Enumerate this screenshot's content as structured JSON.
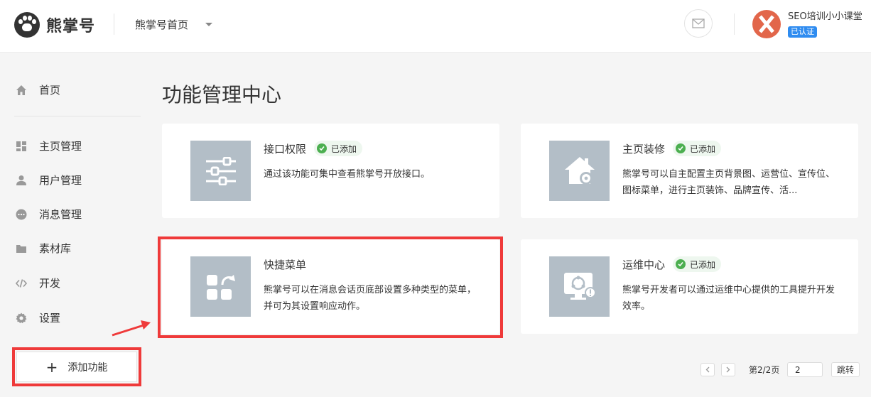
{
  "header": {
    "logo_text": "熊掌号",
    "account_select": "熊掌号首页",
    "user_name": "SEO培训小小课堂",
    "verified_badge": "已认证"
  },
  "sidebar": {
    "items": [
      {
        "label": "首页",
        "icon": "home-icon"
      },
      {
        "label": "主页管理",
        "icon": "dashboard-icon"
      },
      {
        "label": "用户管理",
        "icon": "user-icon"
      },
      {
        "label": "消息管理",
        "icon": "message-icon"
      },
      {
        "label": "素材库",
        "icon": "folder-icon"
      },
      {
        "label": "开发",
        "icon": "code-icon"
      },
      {
        "label": "设置",
        "icon": "gear-icon"
      }
    ],
    "add_button": "添加功能"
  },
  "main": {
    "title": "功能管理中心",
    "cards": [
      {
        "title": "接口权限",
        "badge": "已添加",
        "desc": "通过该功能可集中查看熊掌号开放接口。",
        "icon": "sliders-icon"
      },
      {
        "title": "主页装修",
        "badge": "已添加",
        "desc": "熊掌号可以自主配置主页背景图、运营位、宣传位、图标菜单，进行主页装饰、品牌宣传、活...",
        "icon": "home-settings-icon"
      },
      {
        "title": "快捷菜单",
        "badge": "",
        "desc": "熊掌号可以在消息会话页底部设置多种类型的菜单，并可为其设置响应动作。",
        "icon": "quick-menu-icon"
      },
      {
        "title": "运维中心",
        "badge": "已添加",
        "desc": "熊掌号开发者可以通过运维中心提供的工具提升开发效率。",
        "icon": "monitor-icon"
      }
    ]
  },
  "pagination": {
    "info": "第2/2页",
    "input_value": "2",
    "jump_label": "跳转"
  },
  "colors": {
    "highlight": "#ef3a3a",
    "badge_green": "#4caf50",
    "verified_blue": "#2f8cf0",
    "avatar": "#e2664a"
  }
}
